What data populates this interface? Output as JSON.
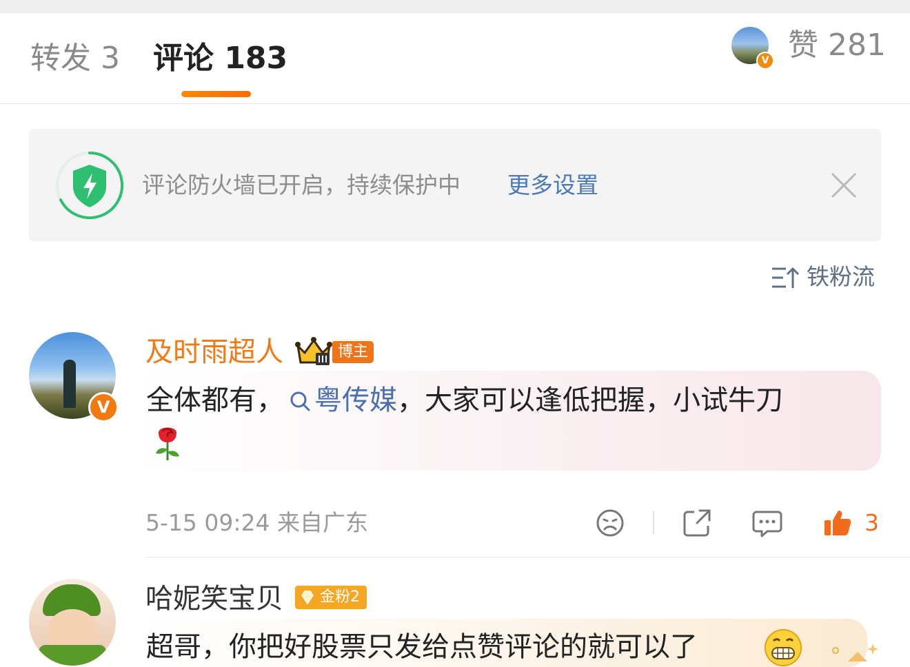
{
  "tabs": {
    "repost_label": "转发 3",
    "comment_label": "评论 183",
    "likes_label": "赞 281"
  },
  "firewall": {
    "message": "评论防火墙已开启，持续保护中",
    "more_settings": "更多设置"
  },
  "sort": {
    "label": "铁粉流"
  },
  "comments": [
    {
      "author": "及时雨超人",
      "badge": "博主",
      "verified_mark": "V",
      "text_before": "全体都有，",
      "topic_link": "粤传媒",
      "text_after": "，大家可以逢低把握，小试牛刀",
      "emoji": "rose",
      "time": "5-15 09:24",
      "location": "来自广东",
      "like_count": "3"
    },
    {
      "author": "哈妮笑宝贝",
      "badge": "金粉2",
      "text": "超哥，你把好股票只发给点赞评论的就可以了",
      "emoji": "grin"
    }
  ],
  "colors": {
    "accent_orange": "#f07a1a",
    "link_blue": "#4a7bb8",
    "like_orange": "#f26a1b",
    "shield_green": "#2fbf71"
  },
  "icons": [
    "shield-icon",
    "close-icon",
    "sort-icon",
    "search-icon",
    "dislike-icon",
    "share-icon",
    "comment-icon",
    "like-icon",
    "crown-icon",
    "gem-icon"
  ]
}
